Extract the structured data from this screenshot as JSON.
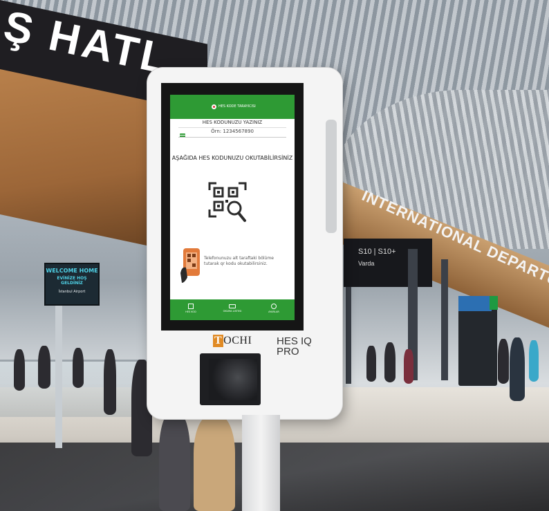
{
  "background": {
    "hall_sign": "Ş HATL",
    "international_sign": "INTERNATIONAL DEPARTURES",
    "ad_board_line1": "S10 | S10+",
    "ad_board_line2": "Varda",
    "welcome_sign": {
      "line1": "WELCOME HOME",
      "line2": "EVİNİZE HOŞ GELDİNİZ",
      "line3": "İstanbul Airport"
    }
  },
  "screen": {
    "header_title": "HES KODE TARAYICISI",
    "title": "HES KODUNUZU YAZINIZ",
    "input_placeholder": "Örn: 1234567890",
    "prompt": "AŞAĞIDA HES KODUNUZU OKUTABİLİRSİNİZ",
    "hint": "Telefonunuzu alt taraftaki bölüme tutarak qr kodu okutabilirsiniz.",
    "nav": [
      {
        "label": "HES KOD"
      },
      {
        "label": "OKUMA LISTESI"
      },
      {
        "label": "AYARLAR"
      }
    ]
  },
  "kiosk": {
    "brand": "OCHI",
    "brand_initial": "T",
    "model_line1": "HES IQ",
    "model_line2": "PRO"
  },
  "colors": {
    "accent_green": "#2e9a34",
    "brand_orange": "#e08a24"
  }
}
